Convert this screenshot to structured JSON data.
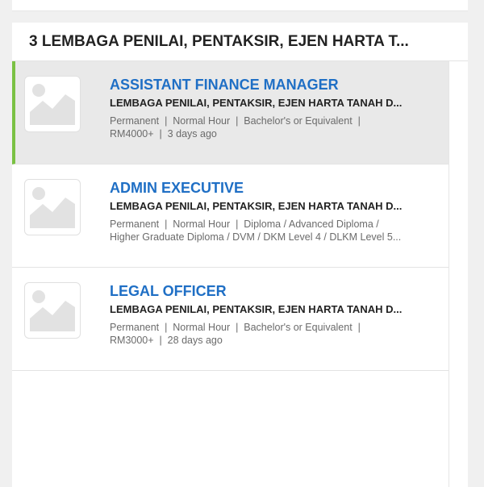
{
  "header": {
    "title": "3 LEMBAGA PENILAI, PENTAKSIR, EJEN HARTA T..."
  },
  "jobs": [
    {
      "title": "ASSISTANT FINANCE MANAGER",
      "company": "LEMBAGA PENILAI, PENTAKSIR, EJEN HARTA TANAH D...",
      "meta_line1": "Permanent  |  Normal Hour  |  Bachelor's or Equivalent  |",
      "meta_line2": "RM4000+  |  3 days ago",
      "logo_icon": "image-placeholder-icon",
      "selected": true
    },
    {
      "title": "ADMIN EXECUTIVE",
      "company": "LEMBAGA PENILAI, PENTAKSIR, EJEN HARTA TANAH D...",
      "meta_line1": "Permanent  |  Normal Hour  |  Diploma / Advanced Diploma /",
      "meta_line2": "Higher Graduate Diploma / DVM / DKM Level 4 / DLKM Level 5...",
      "logo_icon": "image-placeholder-icon",
      "selected": false
    },
    {
      "title": "LEGAL OFFICER",
      "company": "LEMBAGA PENILAI, PENTAKSIR, EJEN HARTA TANAH D...",
      "meta_line1": "Permanent  |  Normal Hour  |  Bachelor's or Equivalent  |",
      "meta_line2": "RM3000+  |  28 days ago",
      "logo_icon": "image-placeholder-icon",
      "selected": false
    }
  ],
  "colors": {
    "accent_selected": "#7ac143",
    "job_title": "#1f6fc5",
    "selected_bg": "#e9e9e9"
  }
}
